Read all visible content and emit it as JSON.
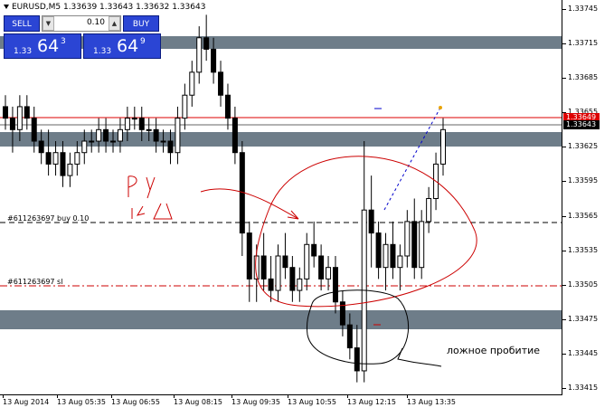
{
  "chart": {
    "title": "EURUSD,M5  1.33639 1.33643 1.33632 1.33643",
    "bars": [
      [
        1.3366,
        1.3367,
        1.3364,
        1.3365
      ],
      [
        1.3365,
        1.3366,
        1.3362,
        1.3364
      ],
      [
        1.3364,
        1.3367,
        1.3363,
        1.3366
      ],
      [
        1.3366,
        1.3367,
        1.3364,
        1.3365
      ],
      [
        1.3365,
        1.3366,
        1.3362,
        1.3363
      ],
      [
        1.3363,
        1.3364,
        1.3361,
        1.3362
      ],
      [
        1.3362,
        1.3364,
        1.336,
        1.3361
      ],
      [
        1.3361,
        1.3363,
        1.336,
        1.3362
      ],
      [
        1.3362,
        1.3363,
        1.3359,
        1.336
      ],
      [
        1.336,
        1.3362,
        1.3359,
        1.3361
      ],
      [
        1.3361,
        1.3363,
        1.336,
        1.3362
      ],
      [
        1.3362,
        1.3364,
        1.3361,
        1.3363
      ],
      [
        1.3363,
        1.3364,
        1.3362,
        1.3363
      ],
      [
        1.3363,
        1.3365,
        1.3362,
        1.3364
      ],
      [
        1.3364,
        1.3365,
        1.3362,
        1.3363
      ],
      [
        1.3363,
        1.3364,
        1.3362,
        1.3363
      ],
      [
        1.3363,
        1.3365,
        1.3362,
        1.3364
      ],
      [
        1.3364,
        1.3366,
        1.3363,
        1.3365
      ],
      [
        1.3365,
        1.3366,
        1.3364,
        1.3365
      ],
      [
        1.3365,
        1.3366,
        1.3363,
        1.3364
      ],
      [
        1.3364,
        1.3365,
        1.3363,
        1.3364
      ],
      [
        1.3364,
        1.3365,
        1.3362,
        1.3363
      ],
      [
        1.3363,
        1.3364,
        1.3362,
        1.3363
      ],
      [
        1.3363,
        1.3364,
        1.3361,
        1.3362
      ],
      [
        1.3362,
        1.3366,
        1.3361,
        1.3365
      ],
      [
        1.3365,
        1.3368,
        1.3364,
        1.3367
      ],
      [
        1.3367,
        1.337,
        1.3366,
        1.3369
      ],
      [
        1.3369,
        1.3373,
        1.3368,
        1.3372
      ],
      [
        1.3372,
        1.3374,
        1.337,
        1.3371
      ],
      [
        1.3371,
        1.3372,
        1.3368,
        1.3369
      ],
      [
        1.3369,
        1.337,
        1.3366,
        1.3367
      ],
      [
        1.3367,
        1.3368,
        1.3364,
        1.3365
      ],
      [
        1.3365,
        1.3366,
        1.3361,
        1.3362
      ],
      [
        1.3362,
        1.3363,
        1.3353,
        1.3355
      ],
      [
        1.3355,
        1.3356,
        1.3349,
        1.3351
      ],
      [
        1.3351,
        1.3354,
        1.3349,
        1.3353
      ],
      [
        1.3353,
        1.3355,
        1.335,
        1.3351
      ],
      [
        1.3351,
        1.3353,
        1.3349,
        1.335
      ],
      [
        1.335,
        1.3354,
        1.3349,
        1.3353
      ],
      [
        1.3353,
        1.3355,
        1.3351,
        1.3352
      ],
      [
        1.3352,
        1.3353,
        1.3349,
        1.335
      ],
      [
        1.335,
        1.3352,
        1.3349,
        1.3351
      ],
      [
        1.3351,
        1.3355,
        1.335,
        1.3354
      ],
      [
        1.3354,
        1.3356,
        1.3352,
        1.3353
      ],
      [
        1.3353,
        1.3354,
        1.335,
        1.3351
      ],
      [
        1.3351,
        1.3353,
        1.335,
        1.3352
      ],
      [
        1.3352,
        1.3353,
        1.3348,
        1.3349
      ],
      [
        1.3349,
        1.335,
        1.3346,
        1.3347
      ],
      [
        1.3347,
        1.3348,
        1.3344,
        1.3345
      ],
      [
        1.3345,
        1.3347,
        1.3342,
        1.3343
      ],
      [
        1.3343,
        1.3363,
        1.3342,
        1.3357
      ],
      [
        1.3357,
        1.336,
        1.3352,
        1.3355
      ],
      [
        1.3355,
        1.3356,
        1.3351,
        1.3352
      ],
      [
        1.3352,
        1.3355,
        1.335,
        1.3354
      ],
      [
        1.3354,
        1.3356,
        1.3351,
        1.3352
      ],
      [
        1.3352,
        1.3354,
        1.335,
        1.3353
      ],
      [
        1.3353,
        1.3357,
        1.3352,
        1.3356
      ],
      [
        1.3356,
        1.3358,
        1.3351,
        1.3352
      ],
      [
        1.3352,
        1.3357,
        1.3351,
        1.3356
      ],
      [
        1.3356,
        1.3359,
        1.3355,
        1.3358
      ],
      [
        1.3358,
        1.3362,
        1.3357,
        1.3361
      ],
      [
        1.3361,
        1.3365,
        1.336,
        1.3364
      ]
    ]
  },
  "otp": {
    "sell_label": "SELL",
    "buy_label": "BUY",
    "lot": "0.10",
    "down_arrow": "▼",
    "up_arrow": "▲",
    "sell_big": "1.33",
    "sell_pips": "64",
    "sell_sup": "3",
    "buy_big": "1.33",
    "buy_pips": "64",
    "buy_sup": "9"
  },
  "price_axis": {
    "labels": [
      "1.33745",
      "1.33715",
      "1.33685",
      "1.33655",
      "1.33625",
      "1.33595",
      "1.33565",
      "1.33535",
      "1.33505",
      "1.33475",
      "1.33445",
      "1.33415"
    ],
    "ask_label": "1.33649",
    "bid_label": "1.33643",
    "ask_color": "#dd0000",
    "bid_color": "#000000"
  },
  "time_axis": {
    "labels": [
      "13 Aug 2014",
      "13 Aug 05:35",
      "13 Aug 06:55",
      "13 Aug 08:15",
      "13 Aug 09:35",
      "13 Aug 10:55",
      "13 Aug 12:15",
      "13 Aug 13:35"
    ]
  },
  "order_lines": {
    "buy_label": "#611263697 buy 0.10",
    "sl_label": "#611263697 sl"
  },
  "annotations": {
    "false_breakout": "ложное пробитие"
  },
  "colors": {
    "zone": "#6e7d89",
    "ask_line": "#dd0000",
    "bid_line": "#000000",
    "sl_line": "#cc0000",
    "trend_line": "#0000cc",
    "drawing_red": "#cc0000",
    "drawing_black": "#000000"
  }
}
